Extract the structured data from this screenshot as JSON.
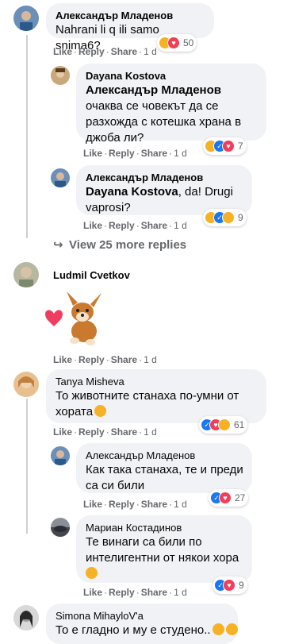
{
  "actions": {
    "like": "Like",
    "reply": "Reply",
    "share": "Share",
    "dot": "·"
  },
  "comments": [
    {
      "author": "Александър Младенов",
      "text": "Nahrani li q ili samo snima6?",
      "time": "1 d",
      "reacts": "50"
    },
    {
      "author": "Dayana Kostova",
      "mention": "Александър Младенов",
      "text": "очаква се човекът да се разхожда с котешка храна в джоба ли?",
      "time": "1 d",
      "reacts": "7"
    },
    {
      "author": "Александър Младенов",
      "mention": "Dayana Kostova",
      "text": ", da! Drugi vaprosi?",
      "time": "1 d",
      "reacts": "9"
    },
    {
      "author": "Ludmil Cvetkov",
      "time": "1 d"
    },
    {
      "author": "Tanya Misheva",
      "text": "То животните станаха по-умни от хората",
      "time": "1 d",
      "reacts": "61"
    },
    {
      "author": "Александър Младенов",
      "text": "Как така станаха, те и преди са си били",
      "time": "1 d",
      "reacts": "27"
    },
    {
      "author": "Мариан Костадинов",
      "text": "Те винаги са били по интелигентни от някои хора",
      "time": "1 d",
      "reacts": "9"
    },
    {
      "author": "Simona MihayloV'a",
      "text": "То е гладно и му е студено.."
    }
  ],
  "view_more": "View 25 more replies",
  "icons": {
    "reply_arrow": "reply-arrow-icon",
    "sticker": "dog-heart-sticker"
  },
  "colors": {
    "bubble": "#f0f2f5",
    "meta": "#65676b",
    "like": "#1877f2",
    "love": "#f33e58",
    "haha": "#f7b125"
  }
}
